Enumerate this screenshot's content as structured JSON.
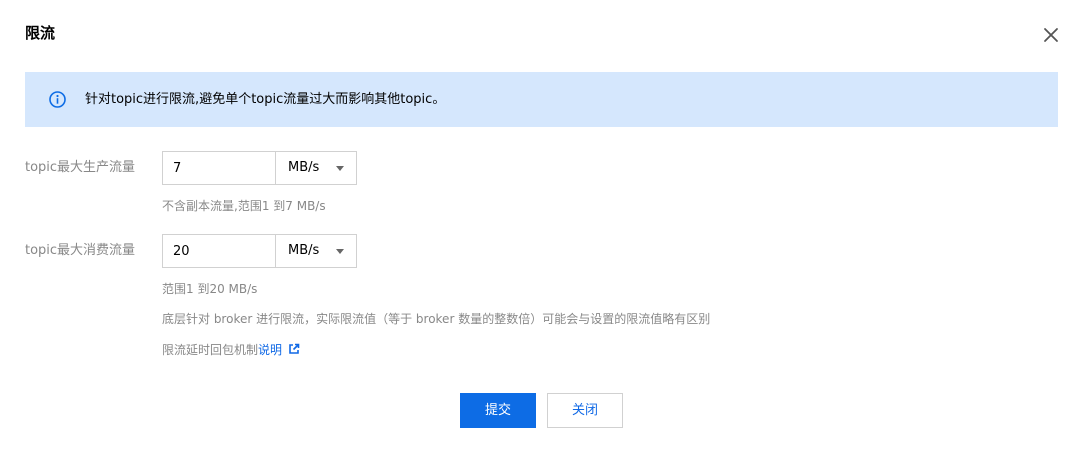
{
  "dialog": {
    "title": "限流",
    "banner_text": "针对topic进行限流,避免单个topic流量过大而影响其他topic。",
    "produce": {
      "label": "topic最大生产流量",
      "value": "7",
      "unit": "MB/s",
      "hint": "不含副本流量,范围1 到7 MB/s"
    },
    "consume": {
      "label": "topic最大消费流量",
      "value": "20",
      "unit": "MB/s",
      "hint_range": "范围1 到20 MB/s",
      "hint_broker": "底层针对 broker 进行限流，实际限流值（等于 broker 数量的整数倍）可能会与设置的限流值略有区别",
      "hint_delay_prefix": "限流延时回包机制",
      "hint_delay_link": "说明"
    },
    "buttons": {
      "submit": "提交",
      "close": "关闭"
    }
  },
  "colors": {
    "primary": "#0d6ce5",
    "link": "#1069e6",
    "banner_bg": "#d5e7fd"
  }
}
